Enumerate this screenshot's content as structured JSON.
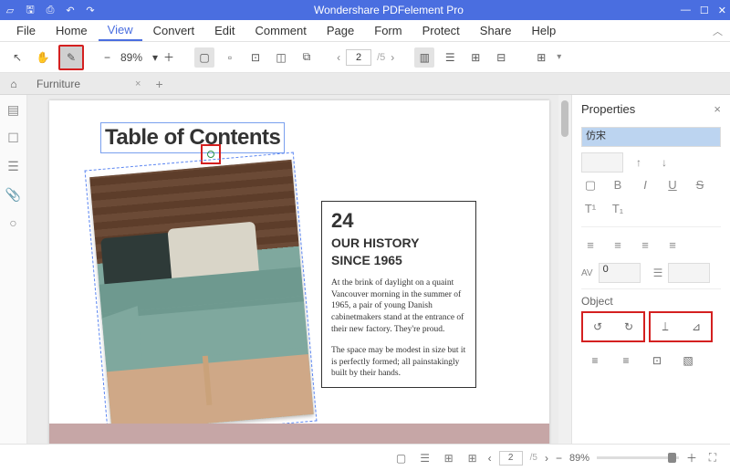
{
  "app": {
    "title": "Wondershare PDFelement Pro"
  },
  "menu": {
    "items": [
      "File",
      "Home",
      "View",
      "Convert",
      "Edit",
      "Comment",
      "Page",
      "Form",
      "Protect",
      "Share",
      "Help"
    ],
    "active": 2
  },
  "toolbar": {
    "zoom": "89%",
    "page_current": "2",
    "page_total": "/5"
  },
  "tabs": {
    "name": "Furniture"
  },
  "document": {
    "title": "Table of Contents",
    "number": "24",
    "heading1": "OUR HISTORY",
    "heading2": "SINCE 1965",
    "para1": "At the brink of daylight on a quaint Vancouver morning in the summer of 1965, a pair of young Danish cabinetmakers stand at the entrance of their new factory. They're proud.",
    "para2": "The space may be modest in size but it is perfectly formed; all painstakingly built by their hands."
  },
  "properties": {
    "header": "Properties",
    "font": "仿宋",
    "spacing_av": "0",
    "object_label": "Object"
  },
  "status": {
    "page_current": "2",
    "page_total": "/5",
    "zoom": "89%"
  },
  "icons": {
    "logo": "▱",
    "save": "🖫",
    "print": "⎙",
    "undo": "↶",
    "redo": "↷",
    "min": "—",
    "max": "☐",
    "close": "✕",
    "cursor": "↖",
    "hand": "✋",
    "edit": "✎",
    "minus": "−",
    "plus": "＋",
    "chev_down": "▾",
    "page1": "▢",
    "page2": "▫",
    "page3": "⊡",
    "page4": "◫",
    "page5": "⧉",
    "prev": "‹",
    "next": "›",
    "view1": "▥",
    "view2": "☰",
    "view3": "⊞",
    "view4": "⊟",
    "view5": "⊞",
    "thumb": "▤",
    "bookmark": "☐",
    "comment": "☰",
    "attach": "📎",
    "search": "○",
    "rect": "▢",
    "bold": "B",
    "italic": "I",
    "under": "U",
    "strike": "S",
    "super": "T¹",
    "sub": "T₁",
    "al": "≡",
    "ac": "≡",
    "ar": "≡",
    "aj": "≡",
    "rotl": "↺",
    "rotr": "↻",
    "fliph": "⟘",
    "flipv": "⊿",
    "fit": "⊡",
    "img": "▧",
    "av": "AV"
  }
}
